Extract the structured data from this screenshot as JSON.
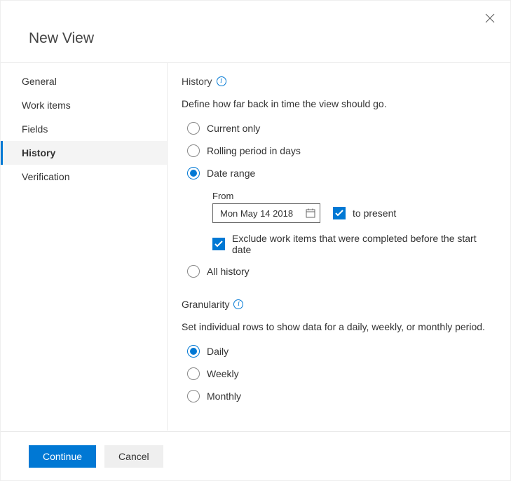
{
  "title": "New View",
  "sidebar": {
    "items": [
      {
        "label": "General",
        "active": false
      },
      {
        "label": "Work items",
        "active": false
      },
      {
        "label": "Fields",
        "active": false
      },
      {
        "label": "History",
        "active": true
      },
      {
        "label": "Verification",
        "active": false
      }
    ]
  },
  "history": {
    "heading": "History",
    "description": "Define how far back in time the view should go.",
    "options": {
      "current_only": "Current only",
      "rolling_period": "Rolling period in days",
      "date_range": "Date range",
      "all_history": "All history"
    },
    "selected": "date_range",
    "dateRange": {
      "fromLabel": "From",
      "fromValue": "Mon May 14 2018",
      "toPresentLabel": "to present",
      "toPresentChecked": true,
      "excludeLabel": "Exclude work items that were completed before the start date",
      "excludeChecked": true
    }
  },
  "granularity": {
    "heading": "Granularity",
    "description": "Set individual rows to show data for a daily, weekly, or monthly period.",
    "options": {
      "daily": "Daily",
      "weekly": "Weekly",
      "monthly": "Monthly"
    },
    "selected": "daily"
  },
  "footer": {
    "continue": "Continue",
    "cancel": "Cancel"
  }
}
